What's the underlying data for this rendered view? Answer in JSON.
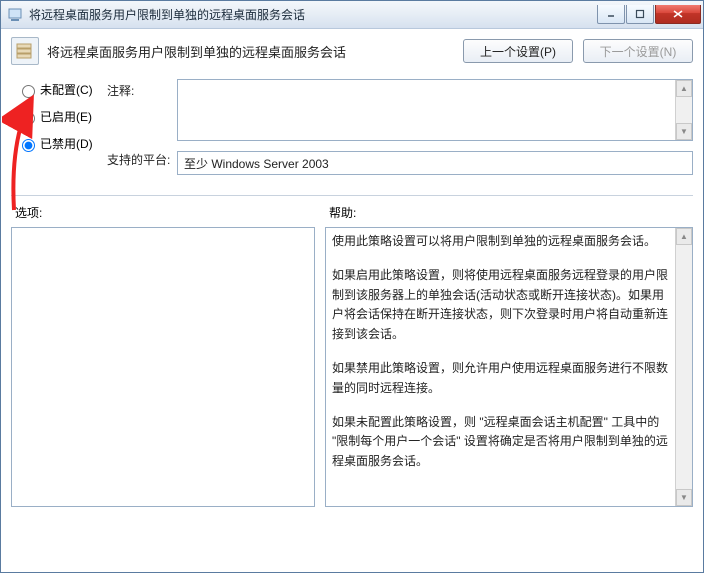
{
  "window": {
    "title": "将远程桌面服务用户限制到单独的远程桌面服务会话"
  },
  "header": {
    "title": "将远程桌面服务用户限制到单独的远程桌面服务会话",
    "prev": "上一个设置(P)",
    "next": "下一个设置(N)"
  },
  "radios": {
    "notconfigured": "未配置(C)",
    "enabled": "已启用(E)",
    "disabled": "已禁用(D)"
  },
  "labels": {
    "comment": "注释:",
    "platform": "支持的平台:",
    "options": "选项:",
    "help": "帮助:"
  },
  "platform": "至少 Windows Server 2003",
  "help": {
    "p1": "使用此策略设置可以将用户限制到单独的远程桌面服务会话。",
    "p2": "如果启用此策略设置，则将使用远程桌面服务远程登录的用户限制到该服务器上的单独会话(活动状态或断开连接状态)。如果用户将会话保持在断开连接状态，则下次登录时用户将自动重新连接到该会话。",
    "p3": "如果禁用此策略设置，则允许用户使用远程桌面服务进行不限数量的同时远程连接。",
    "p4": "如果未配置此策略设置，则 \"远程桌面会话主机配置\" 工具中的 \"限制每个用户一个会话\" 设置将确定是否将用户限制到单独的远程桌面服务会话。"
  }
}
